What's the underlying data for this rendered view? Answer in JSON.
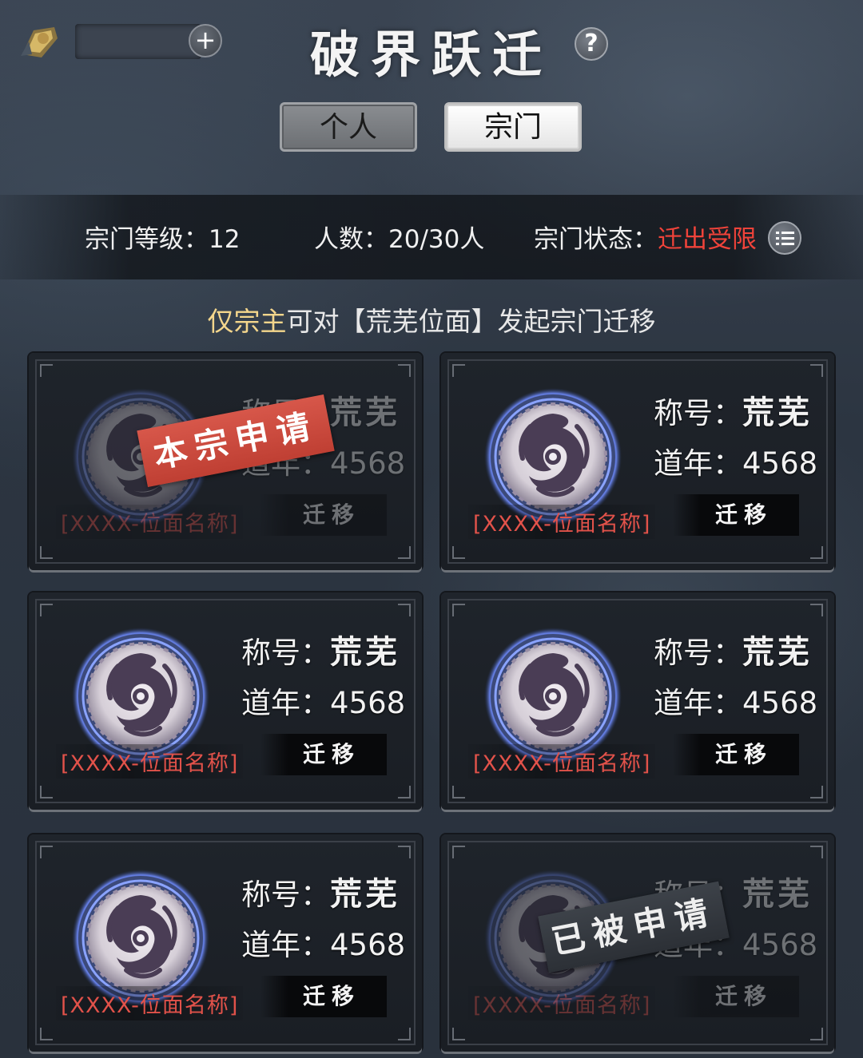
{
  "header": {
    "title": "破界跃迁",
    "help_label": "?",
    "add_label": "+"
  },
  "tabs": [
    {
      "label": "个人",
      "active": false
    },
    {
      "label": "宗门",
      "active": true
    }
  ],
  "sect_info": {
    "level_label": "宗门等级：",
    "level_value": "12",
    "count_label": "人数：",
    "count_value": "20/30人",
    "status_label": "宗门状态：",
    "status_value": "迁出受限",
    "status_color": "#f0433a"
  },
  "notice": {
    "highlight": "仅宗主",
    "rest": "可对【荒芜位面】发起宗门迁移",
    "highlight_color": "#f4d68c"
  },
  "cards": [
    {
      "title_label": "称号：",
      "title_value": "荒芜",
      "year_label": "道年：",
      "year_value": "4568",
      "plane_name": "[XXXX-位面名称]",
      "button": "迁移",
      "stamp": "本宗申请"
    },
    {
      "title_label": "称号：",
      "title_value": "荒芜",
      "year_label": "道年：",
      "year_value": "4568",
      "plane_name": "[XXXX-位面名称]",
      "button": "迁移"
    },
    {
      "title_label": "称号：",
      "title_value": "荒芜",
      "year_label": "道年：",
      "year_value": "4568",
      "plane_name": "[XXXX-位面名称]",
      "button": "迁移"
    },
    {
      "title_label": "称号：",
      "title_value": "荒芜",
      "year_label": "道年：",
      "year_value": "4568",
      "plane_name": "[XXXX-位面名称]",
      "button": "迁移"
    },
    {
      "title_label": "称号：",
      "title_value": "荒芜",
      "year_label": "道年：",
      "year_value": "4568",
      "plane_name": "[XXXX-位面名称]",
      "button": "迁移"
    },
    {
      "title_label": "称号：",
      "title_value": "荒芜",
      "year_label": "道年：",
      "year_value": "4568",
      "plane_name": "[XXXX-位面名称]",
      "button": "迁移",
      "stamp": "已被申请"
    }
  ],
  "icons": {
    "currency": "gold-token-icon",
    "add": "plus-icon",
    "help": "question-icon",
    "list": "list-icon",
    "emblem": "dragon-emblem-icon"
  }
}
